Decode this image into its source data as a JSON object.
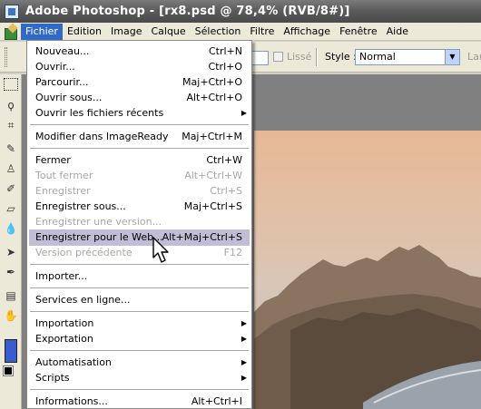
{
  "window": {
    "title": "Adobe Photoshop - [rx8.psd @ 78,4% (RVB/8#)]"
  },
  "menubar": {
    "items": [
      {
        "label": "Fichier"
      },
      {
        "label": "Edition"
      },
      {
        "label": "Image"
      },
      {
        "label": "Calque"
      },
      {
        "label": "Sélection"
      },
      {
        "label": "Filtre"
      },
      {
        "label": "Affichage"
      },
      {
        "label": "Fenêtre"
      },
      {
        "label": "Aide"
      }
    ]
  },
  "options": {
    "lisse_label": "Lissé",
    "style_label": "Style :",
    "style_value": "Normal",
    "cut_label": "Lar"
  },
  "file_menu": {
    "items": [
      {
        "label": "Nouveau...",
        "shortcut": "Ctrl+N"
      },
      {
        "label": "Ouvrir...",
        "shortcut": "Ctrl+O"
      },
      {
        "label": "Parcourir...",
        "shortcut": "Maj+Ctrl+O"
      },
      {
        "label": "Ouvrir sous...",
        "shortcut": "Alt+Ctrl+O"
      },
      {
        "label": "Ouvrir les fichiers récents",
        "shortcut": ""
      },
      {
        "label": "Modifier dans ImageReady",
        "shortcut": "Maj+Ctrl+M"
      },
      {
        "label": "Fermer",
        "shortcut": "Ctrl+W"
      },
      {
        "label": "Tout fermer",
        "shortcut": "Alt+Ctrl+W"
      },
      {
        "label": "Enregistrer",
        "shortcut": "Ctrl+S"
      },
      {
        "label": "Enregistrer sous...",
        "shortcut": "Maj+Ctrl+S"
      },
      {
        "label": "Enregistrer une version...",
        "shortcut": ""
      },
      {
        "label": "Enregistrer pour le Web...",
        "shortcut": "Alt+Maj+Ctrl+S"
      },
      {
        "label": "Version précédente",
        "shortcut": "F12"
      },
      {
        "label": "Importer...",
        "shortcut": ""
      },
      {
        "label": "Services en ligne...",
        "shortcut": ""
      },
      {
        "label": "Importation",
        "shortcut": ""
      },
      {
        "label": "Exportation",
        "shortcut": ""
      },
      {
        "label": "Automatisation",
        "shortcut": ""
      },
      {
        "label": "Scripts",
        "shortcut": ""
      },
      {
        "label": "Informations...",
        "shortcut": "Alt+Ctrl+I"
      }
    ]
  }
}
